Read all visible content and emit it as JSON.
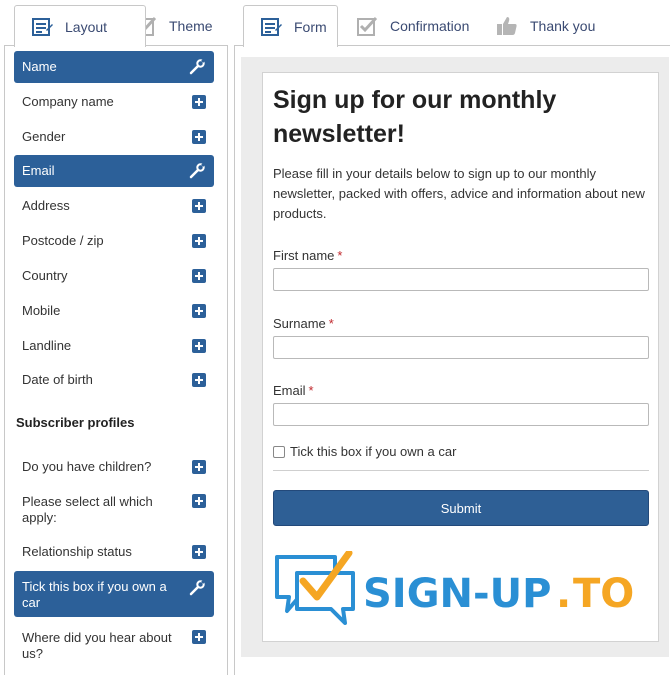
{
  "left_tabs": [
    {
      "label": "Layout",
      "icon": "form-icon",
      "active": true
    },
    {
      "label": "Theme",
      "icon": "checkmark-icon",
      "active": false
    }
  ],
  "right_tabs": [
    {
      "label": "Form",
      "icon": "form-icon",
      "active": true
    },
    {
      "label": "Confirmation",
      "icon": "checkmark-icon",
      "active": false
    },
    {
      "label": "Thank you",
      "icon": "thumbs-up-icon",
      "active": false
    }
  ],
  "fields": [
    {
      "label": "Name",
      "active": true
    },
    {
      "label": "Company name",
      "active": false
    },
    {
      "label": "Gender",
      "active": false
    },
    {
      "label": "Email",
      "active": true
    },
    {
      "label": "Address",
      "active": false
    },
    {
      "label": "Postcode / zip",
      "active": false
    },
    {
      "label": "Country",
      "active": false
    },
    {
      "label": "Mobile",
      "active": false
    },
    {
      "label": "Landline",
      "active": false
    },
    {
      "label": "Date of birth",
      "active": false
    }
  ],
  "subscriber_profiles_heading": "Subscriber profiles",
  "profile_fields": [
    {
      "label": "Do you have children?",
      "active": false
    },
    {
      "label": "Please select all which apply:",
      "active": false
    },
    {
      "label": "Relationship status",
      "active": false
    },
    {
      "label": "Tick this box if you own a car",
      "active": true
    },
    {
      "label": "Where did you hear about us?",
      "active": false
    }
  ],
  "form": {
    "title": "Sign up for our monthly newsletter!",
    "intro": "Please fill in your details below to sign up to our monthly newsletter, packed with offers, advice and information about new products.",
    "required_marker": "*",
    "first_name_label": "First name",
    "first_name_value": "",
    "surname_label": "Surname",
    "surname_value": "",
    "email_label": "Email",
    "email_value": "",
    "car_checkbox_label": "Tick this box if you own a car",
    "car_checkbox_checked": false,
    "submit_label": "Submit"
  },
  "logo": {
    "text_main": "SIGN-UP",
    "text_dot": ".",
    "text_suffix": "TO",
    "brand_blue": "#2a8fd4",
    "brand_orange": "#f5a623"
  },
  "colors": {
    "accent": "#2c6099",
    "tab_text": "#3a4a72",
    "required": "#c0282d"
  }
}
